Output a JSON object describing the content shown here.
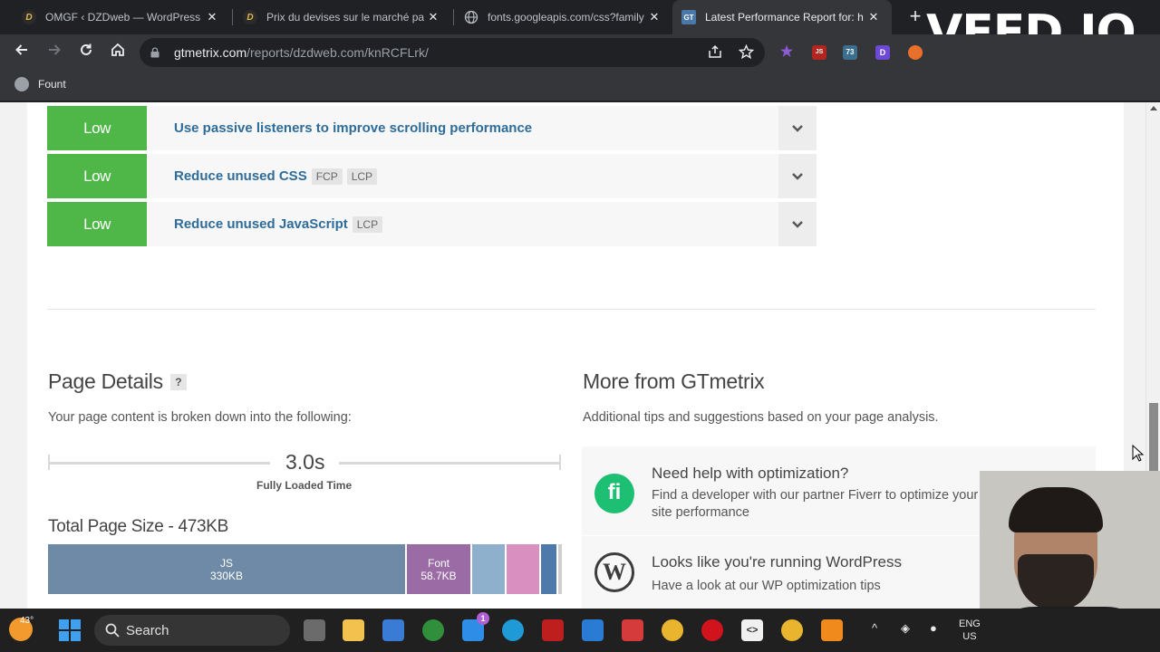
{
  "browser": {
    "tabs": [
      {
        "title": "OMGF ‹ DZDweb — WordPress",
        "icon": "d-letter-icon",
        "active": false
      },
      {
        "title": "Prix du devises sur le marché pa",
        "icon": "d-letter-icon",
        "active": false
      },
      {
        "title": "fonts.googleapis.com/css?family",
        "icon": "globe-icon",
        "active": false
      },
      {
        "title": "Latest Performance Report for: h",
        "icon": "gtmetrix-icon",
        "active": true
      }
    ],
    "tab_close": "✕",
    "new_tab": "+",
    "watermark": "VEED.IO",
    "url_domain": "gtmetrix.com",
    "url_path": "/reports/dzdweb.com/knRCFLrk/",
    "bookmark": "Fount",
    "extension_badge": "73",
    "extension_js": "JS",
    "extension_d": "D"
  },
  "audits": [
    {
      "impact": "Low",
      "title": "Use passive listeners to improve scrolling performance",
      "tags": []
    },
    {
      "impact": "Low",
      "title": "Reduce unused CSS",
      "tags": [
        "FCP",
        "LCP"
      ]
    },
    {
      "impact": "Low",
      "title": "Reduce unused JavaScript",
      "tags": [
        "LCP"
      ]
    }
  ],
  "page_details": {
    "heading": "Page Details",
    "help": "?",
    "description": "Your page content is broken down into the following:",
    "fully_loaded_value": "3.0s",
    "fully_loaded_label": "Fully Loaded Time",
    "total_size_heading": "Total Page Size - 473KB",
    "segments": [
      {
        "label": "JS",
        "size": "330KB",
        "kb": 330,
        "color": "#6f8aa6"
      },
      {
        "label": "Font",
        "size": "58.7KB",
        "kb": 58.7,
        "color": "#9b6ba6"
      },
      {
        "label": "",
        "size": "",
        "kb": 30,
        "color": "#8fb0cc"
      },
      {
        "label": "",
        "size": "",
        "kb": 30,
        "color": "#d98fbf"
      },
      {
        "label": "",
        "size": "",
        "kb": 14,
        "color": "#4d7aaa"
      },
      {
        "label": "",
        "size": "",
        "kb": 3,
        "color": "#cfcfcf"
      }
    ]
  },
  "more_from": {
    "heading": "More from GTmetrix",
    "description": "Additional tips and suggestions based on your page analysis.",
    "items": [
      {
        "logo": "fi",
        "title": "Need help with optimization?",
        "desc": "Find a developer with our partner Fiverr to optimize your site performance"
      },
      {
        "logo": "W",
        "title": "Looks like you're running WordPress",
        "desc": "Have a look at our WP optimization tips"
      }
    ]
  },
  "taskbar": {
    "weather_temp": "43°",
    "search_label": "Search",
    "mail_badge": "1",
    "lang_top": "ENG",
    "lang_bottom": "US"
  },
  "colors": {
    "low_badge": "#4fb748",
    "audit_link": "#2e6c9a"
  }
}
